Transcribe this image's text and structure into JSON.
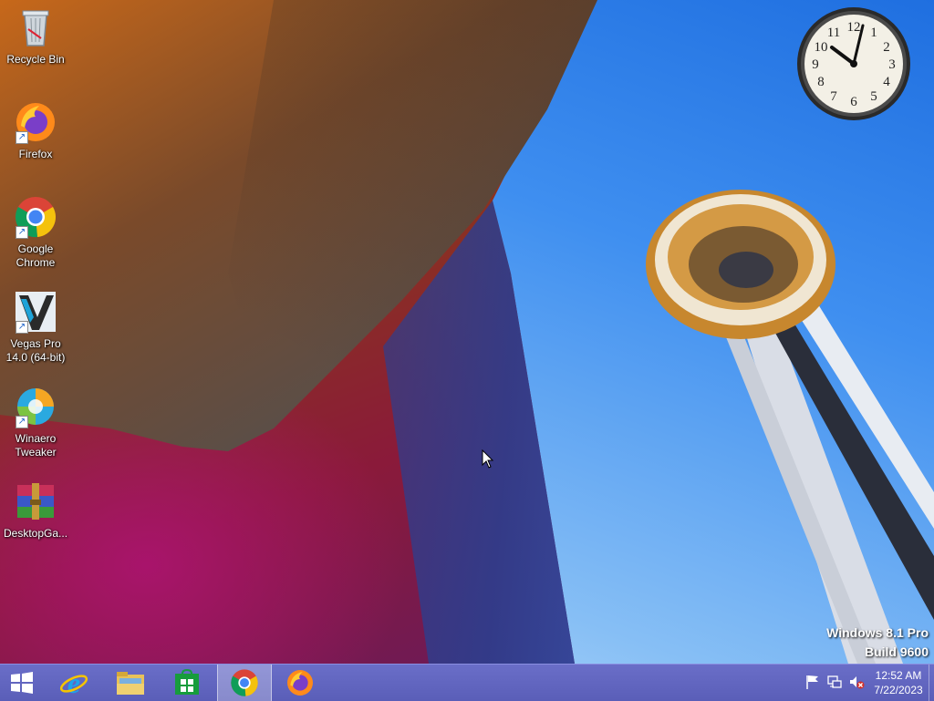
{
  "desktop_icons": [
    {
      "label": "Recycle Bin",
      "icon": "recycle-bin-icon"
    },
    {
      "label": "Firefox",
      "icon": "firefox-icon"
    },
    {
      "label": "Google Chrome",
      "icon": "chrome-icon"
    },
    {
      "label": "Vegas Pro 14.0 (64-bit)",
      "icon": "vegas-pro-icon"
    },
    {
      "label": "Winaero Tweaker",
      "icon": "winaero-tweaker-icon"
    },
    {
      "label": "DesktopGa...",
      "icon": "winrar-archive-icon"
    }
  ],
  "clock_gadget": {
    "numbers": [
      "12",
      "1",
      "2",
      "3",
      "4",
      "5",
      "6",
      "7",
      "8",
      "9",
      "10",
      "11"
    ]
  },
  "watermark": {
    "line1": "Windows 8.1 Pro",
    "line2": "Build 9600"
  },
  "taskbar": {
    "pinned": [
      {
        "icon": "internet-explorer-icon"
      },
      {
        "icon": "file-explorer-icon"
      },
      {
        "icon": "store-icon"
      },
      {
        "icon": "chrome-icon"
      },
      {
        "icon": "firefox-icon"
      }
    ],
    "tray": {
      "time": "12:52 AM",
      "date": "7/22/2023"
    }
  },
  "colors": {
    "taskbar": "#5a5eb8",
    "active_button": "#8a8ed8"
  }
}
